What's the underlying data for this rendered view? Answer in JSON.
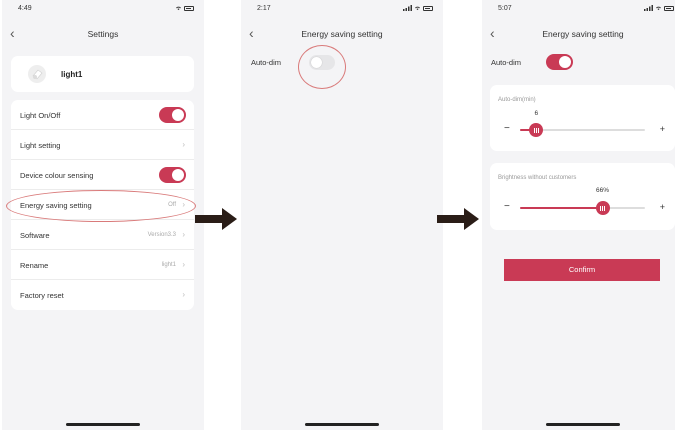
{
  "screen1": {
    "time": "4:49",
    "title": "Settings",
    "device_name": "light1",
    "rows": [
      {
        "label": "Light On/Off",
        "value": "",
        "toggle": true
      },
      {
        "label": "Light setting",
        "value": "",
        "toggle": false
      },
      {
        "label": "Device colour sensing",
        "value": "",
        "toggle": true
      },
      {
        "label": "Energy saving setting",
        "value": "Off",
        "toggle": false
      },
      {
        "label": "Software",
        "value": "Version3.3",
        "toggle": false
      },
      {
        "label": "Rename",
        "value": "light1",
        "toggle": false
      },
      {
        "label": "Factory reset",
        "value": "",
        "toggle": false
      }
    ]
  },
  "screen2": {
    "time": "2:17",
    "title": "Energy saving setting",
    "autodim_label": "Auto-dim",
    "autodim_on": false
  },
  "screen3": {
    "time": "5:07",
    "title": "Energy saving setting",
    "autodim_label": "Auto-dim",
    "autodim_on": true,
    "autodim_min": {
      "label": "Auto-dim(min)",
      "value": "6",
      "level": 0.13
    },
    "brightness": {
      "label": "Brightness without customers",
      "value": "66%",
      "level": 0.66
    },
    "confirm_label": "Confirm"
  },
  "symbols": {
    "back": "‹",
    "chevron": "›",
    "minus": "−",
    "plus": "+"
  },
  "colors": {
    "accent": "#c93a55",
    "annotation": "#d97a7a",
    "arrow": "#2a1d17"
  }
}
